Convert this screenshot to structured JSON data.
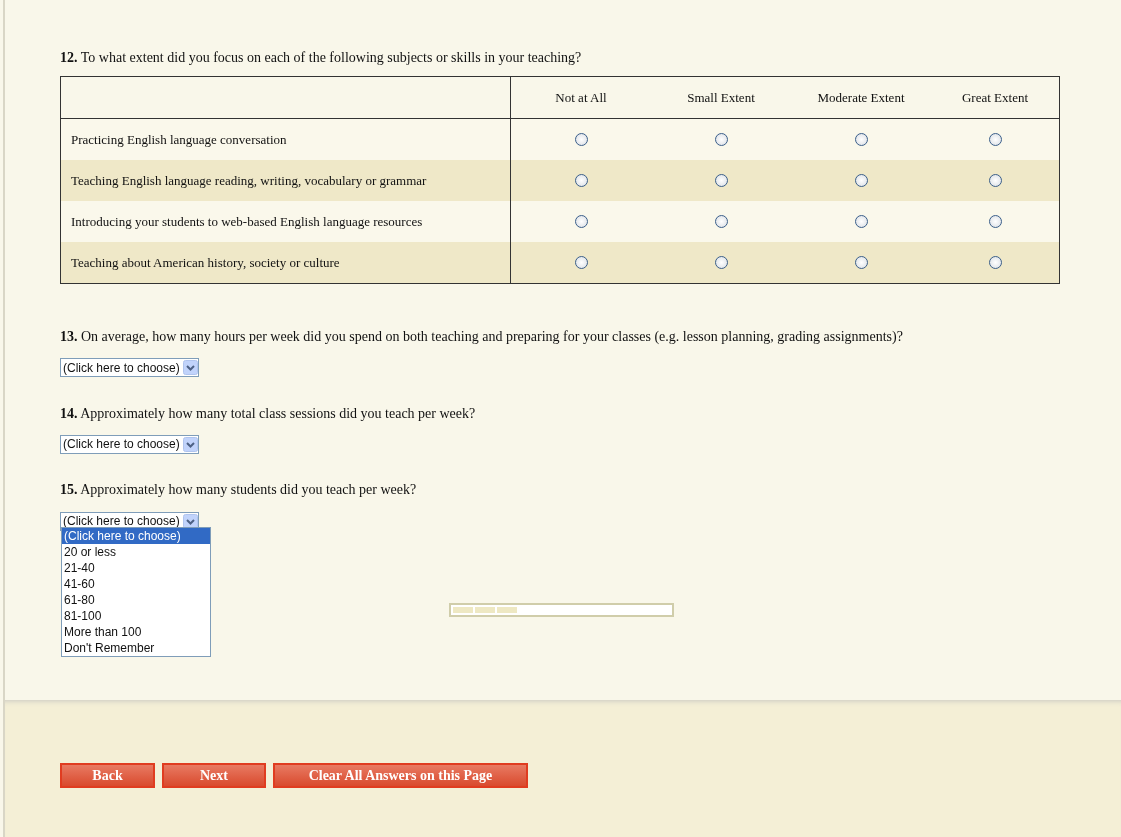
{
  "matrix_question": {
    "number": "12.",
    "text": "To what extent did you focus on each of the following subjects or skills in your teaching?",
    "columns": [
      "Not at All",
      "Small Extent",
      "Moderate Extent",
      "Great Extent"
    ],
    "rows": [
      {
        "label": "Practicing English language conversation",
        "choices": [
          {
            "selected": false
          },
          {
            "selected": false
          },
          {
            "selected": false
          },
          {
            "selected": false
          }
        ]
      },
      {
        "label": "Teaching English language reading, writing, vocabulary or grammar",
        "choices": [
          {
            "selected": false
          },
          {
            "selected": false
          },
          {
            "selected": false
          },
          {
            "selected": false
          }
        ]
      },
      {
        "label": "Introducing your students to web-based English language resources",
        "choices": [
          {
            "selected": false
          },
          {
            "selected": false
          },
          {
            "selected": false
          },
          {
            "selected": false
          }
        ]
      },
      {
        "label": "Teaching about American history, society or culture",
        "choices": [
          {
            "selected": false
          },
          {
            "selected": false
          },
          {
            "selected": false
          },
          {
            "selected": false
          }
        ]
      }
    ]
  },
  "dropdown_questions": [
    {
      "number": "13.",
      "text": "On average, how many hours per week did you spend on both teaching and preparing for your classes (e.g. lesson planning, grading assignments)?",
      "value": "(Click here to choose)",
      "expanded": false
    },
    {
      "number": "14.",
      "text": "Approximately how many total class sessions did you teach per week?",
      "value": "(Click here to choose)",
      "expanded": false
    },
    {
      "number": "15.",
      "text": "Approximately how many students did you teach per week?",
      "value": "(Click here to choose)",
      "expanded": true,
      "options": [
        {
          "label": "(Click here to choose)",
          "selected": true
        },
        {
          "label": "20 or less",
          "selected": false
        },
        {
          "label": "21-40",
          "selected": false
        },
        {
          "label": "41-60",
          "selected": false
        },
        {
          "label": "61-80",
          "selected": false
        },
        {
          "label": "81-100",
          "selected": false
        },
        {
          "label": "More than 100",
          "selected": false
        },
        {
          "label": "Don't Remember",
          "selected": false
        }
      ]
    }
  ],
  "progress": {
    "level": 0.3
  },
  "buttons": [
    "Back",
    "Next",
    "Clear All Answers on this Page"
  ]
}
